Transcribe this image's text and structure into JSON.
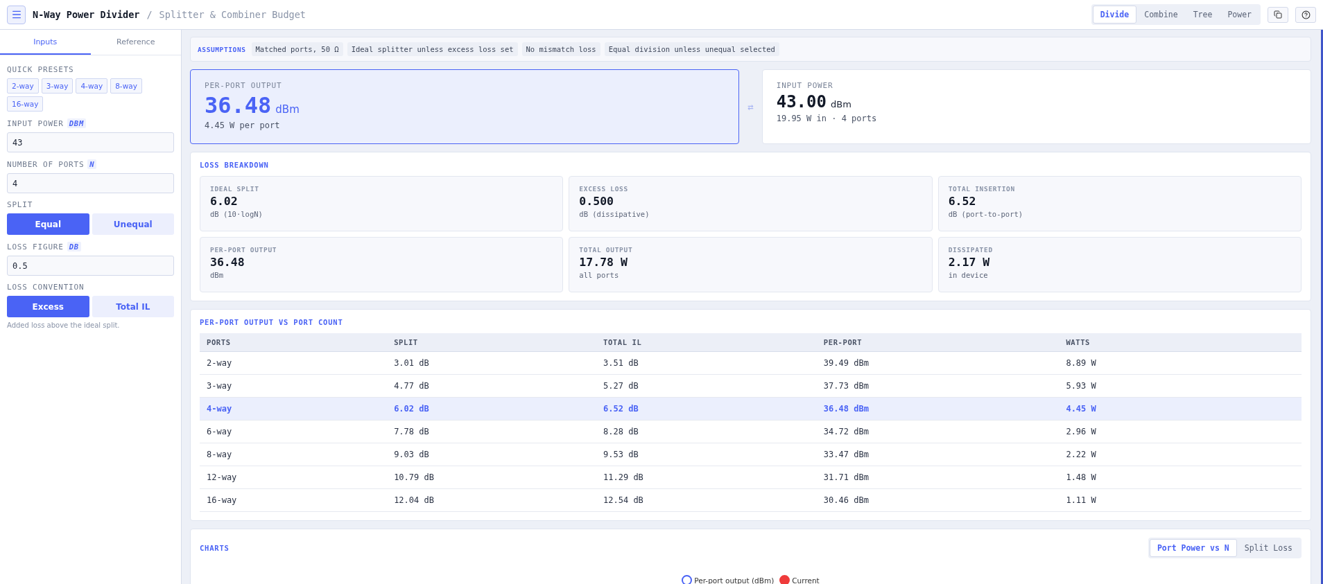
{
  "header": {
    "title": "N-Way Power Divider",
    "separator": "/",
    "subtitle": "Splitter & Combiner Budget",
    "mode_tabs": [
      {
        "label": "Divide",
        "selected": true
      },
      {
        "label": "Combine",
        "selected": false
      },
      {
        "label": "Tree",
        "selected": false
      },
      {
        "label": "Power",
        "selected": false
      }
    ]
  },
  "sidebar": {
    "tabs": [
      {
        "label": "Inputs",
        "selected": true
      },
      {
        "label": "Reference",
        "selected": false
      }
    ],
    "presets": {
      "label": "QUICK PRESETS",
      "items": [
        "2-way",
        "3-way",
        "4-way",
        "8-way",
        "16-way"
      ]
    },
    "fields": [
      {
        "kind": "input",
        "label": "INPUT POWER",
        "unit": "DBM",
        "value": "43"
      },
      {
        "kind": "input",
        "label": "NUMBER OF PORTS",
        "unit": "N",
        "value": "4"
      },
      {
        "kind": "toggle",
        "label": "SPLIT",
        "options": [
          {
            "label": "Equal",
            "selected": true
          },
          {
            "label": "Unequal",
            "selected": false
          }
        ]
      },
      {
        "kind": "input",
        "label": "LOSS FIGURE",
        "unit": "DB",
        "value": "0.5"
      },
      {
        "kind": "toggle",
        "label": "LOSS CONVENTION",
        "options": [
          {
            "label": "Excess",
            "selected": true
          },
          {
            "label": "Total IL",
            "selected": false
          }
        ],
        "note": "Added loss above the ideal split."
      }
    ]
  },
  "assumptions": {
    "label": "ASSUMPTIONS",
    "items": [
      "Matched ports, 50 Ω",
      "Ideal splitter unless excess loss set",
      "No mismatch loss",
      "Equal division unless unequal selected"
    ]
  },
  "hero": [
    {
      "label": "PER-PORT OUTPUT",
      "value": "36.48",
      "unit": "dBm",
      "sub": "4.45 W per port",
      "selected": true
    },
    {
      "label": "INPUT POWER",
      "value": "43.00",
      "unit": "dBm",
      "sub": "19.95 W in · 4 ports",
      "selected": false
    }
  ],
  "swap_symbol": "⇄",
  "loss_breakdown": {
    "title": "LOSS BREAKDOWN",
    "stats": [
      {
        "label": "IDEAL SPLIT",
        "value": "6.02",
        "sub": "dB (10·logN)"
      },
      {
        "label": "EXCESS LOSS",
        "value": "0.500",
        "sub": "dB (dissipative)"
      },
      {
        "label": "TOTAL INSERTION",
        "value": "6.52",
        "sub": "dB (port-to-port)"
      },
      {
        "label": "PER-PORT OUTPUT",
        "value": "36.48",
        "sub": "dBm"
      },
      {
        "label": "TOTAL OUTPUT",
        "value": "17.78 W",
        "sub": "all ports"
      },
      {
        "label": "DISSIPATED",
        "value": "2.17 W",
        "sub": "in device"
      }
    ]
  },
  "table": {
    "title": "PER-PORT OUTPUT VS PORT COUNT",
    "columns": [
      "PORTS",
      "SPLIT",
      "TOTAL IL",
      "PER-PORT",
      "WATTS"
    ],
    "rows": [
      {
        "cells": [
          "2-way",
          "3.01 dB",
          "3.51 dB",
          "39.49 dBm",
          "8.89 W"
        ],
        "selected": false
      },
      {
        "cells": [
          "3-way",
          "4.77 dB",
          "5.27 dB",
          "37.73 dBm",
          "5.93 W"
        ],
        "selected": false
      },
      {
        "cells": [
          "4-way",
          "6.02 dB",
          "6.52 dB",
          "36.48 dBm",
          "4.45 W"
        ],
        "selected": true
      },
      {
        "cells": [
          "6-way",
          "7.78 dB",
          "8.28 dB",
          "34.72 dBm",
          "2.96 W"
        ],
        "selected": false
      },
      {
        "cells": [
          "8-way",
          "9.03 dB",
          "9.53 dB",
          "33.47 dBm",
          "2.22 W"
        ],
        "selected": false
      },
      {
        "cells": [
          "12-way",
          "10.79 dB",
          "11.29 dB",
          "31.71 dBm",
          "1.48 W"
        ],
        "selected": false
      },
      {
        "cells": [
          "16-way",
          "12.04 dB",
          "12.54 dB",
          "30.46 dBm",
          "1.11 W"
        ],
        "selected": false
      }
    ]
  },
  "charts": {
    "title": "CHARTS",
    "tabs": [
      {
        "label": "Port Power vs N",
        "selected": true
      },
      {
        "label": "Split Loss",
        "selected": false
      }
    ],
    "legend": [
      {
        "label": "Per-port output (dBm)",
        "kind": "ring",
        "color": "#4a63f5"
      },
      {
        "label": "Current",
        "kind": "dot",
        "color": "#ef3b3b"
      }
    ]
  }
}
